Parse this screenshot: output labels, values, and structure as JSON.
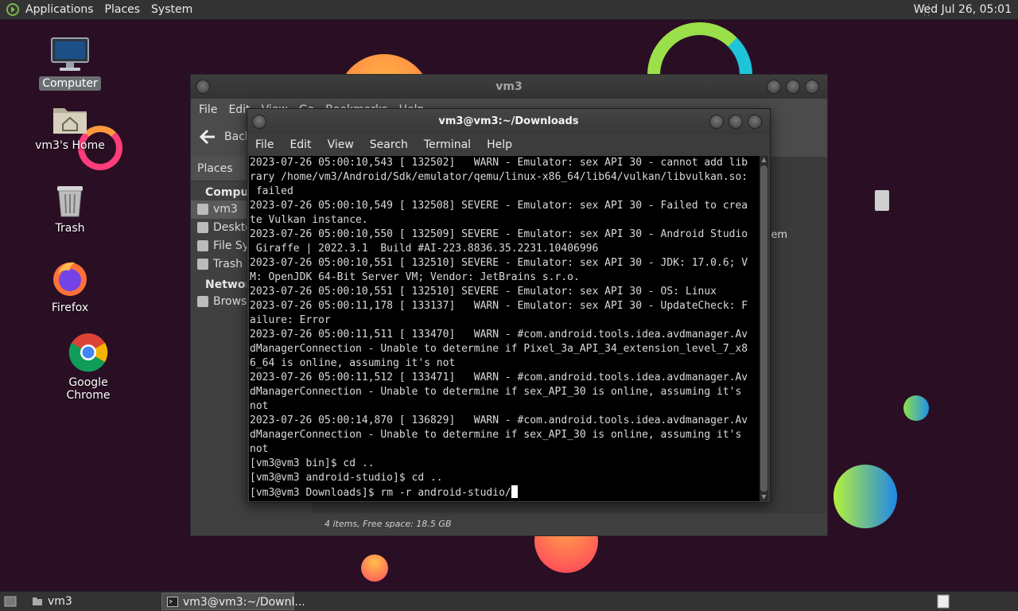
{
  "top_panel": {
    "menus": [
      "Applications",
      "Places",
      "System"
    ],
    "clock": "Wed Jul 26, 05:01"
  },
  "desktop_icons": [
    {
      "label": "Computer",
      "icon": "computer-icon"
    },
    {
      "label": "vm3's Home",
      "icon": "home-folder-icon"
    },
    {
      "label": "Trash",
      "icon": "trash-icon"
    },
    {
      "label": "Firefox",
      "icon": "firefox-icon"
    },
    {
      "label": "Google Chrome",
      "icon": "chrome-icon"
    }
  ],
  "file_manager": {
    "title": "vm3",
    "menus": [
      "File",
      "Edit",
      "View",
      "Go",
      "Bookmarks",
      "Help"
    ],
    "back_label": "Back",
    "side_header": "Places",
    "side_sections": {
      "computer": "Computer",
      "network": "Network"
    },
    "side_items": [
      "vm3",
      "Desktop",
      "File System",
      "Trash",
      "Browse Network"
    ],
    "visible_item_label": "em",
    "status": "4 items, Free space: 18.5 GB"
  },
  "terminal": {
    "title": "vm3@vm3:~/Downloads",
    "menus": [
      "File",
      "Edit",
      "View",
      "Search",
      "Terminal",
      "Help"
    ],
    "lines": [
      "2023-07-26 05:00:10,543 [ 132502]   WARN - Emulator: sex API 30 - cannot add lib",
      "rary /home/vm3/Android/Sdk/emulator/qemu/linux-x86_64/lib64/vulkan/libvulkan.so:",
      " failed",
      "2023-07-26 05:00:10,549 [ 132508] SEVERE - Emulator: sex API 30 - Failed to crea",
      "te Vulkan instance.",
      "2023-07-26 05:00:10,550 [ 132509] SEVERE - Emulator: sex API 30 - Android Studio",
      " Giraffe | 2022.3.1  Build #AI-223.8836.35.2231.10406996",
      "2023-07-26 05:00:10,551 [ 132510] SEVERE - Emulator: sex API 30 - JDK: 17.0.6; V",
      "M: OpenJDK 64-Bit Server VM; Vendor: JetBrains s.r.o.",
      "2023-07-26 05:00:10,551 [ 132510] SEVERE - Emulator: sex API 30 - OS: Linux",
      "2023-07-26 05:00:11,178 [ 133137]   WARN - Emulator: sex API 30 - UpdateCheck: F",
      "ailure: Error",
      "2023-07-26 05:00:11,511 [ 133470]   WARN - #com.android.tools.idea.avdmanager.Av",
      "dManagerConnection - Unable to determine if Pixel_3a_API_34_extension_level_7_x8",
      "6_64 is online, assuming it's not",
      "2023-07-26 05:00:11,512 [ 133471]   WARN - #com.android.tools.idea.avdmanager.Av",
      "dManagerConnection - Unable to determine if sex_API_30 is online, assuming it's",
      "not",
      "2023-07-26 05:00:14,870 [ 136829]   WARN - #com.android.tools.idea.avdmanager.Av",
      "dManagerConnection - Unable to determine if sex_API_30 is online, assuming it's",
      "not",
      "[vm3@vm3 bin]$ cd ..",
      "[vm3@vm3 android-studio]$ cd .."
    ],
    "prompt": "[vm3@vm3 Downloads]$ ",
    "current_input": "rm -r android-studio/"
  },
  "taskbar": {
    "tasks": [
      {
        "label": "vm3",
        "active": false
      },
      {
        "label": "vm3@vm3:~/Downl...",
        "active": true
      }
    ]
  },
  "colors": {
    "desktop_bg": "#2a0f24",
    "panel_bg": "#333333",
    "terminal_bg": "#000000",
    "terminal_fg": "#dadada"
  }
}
